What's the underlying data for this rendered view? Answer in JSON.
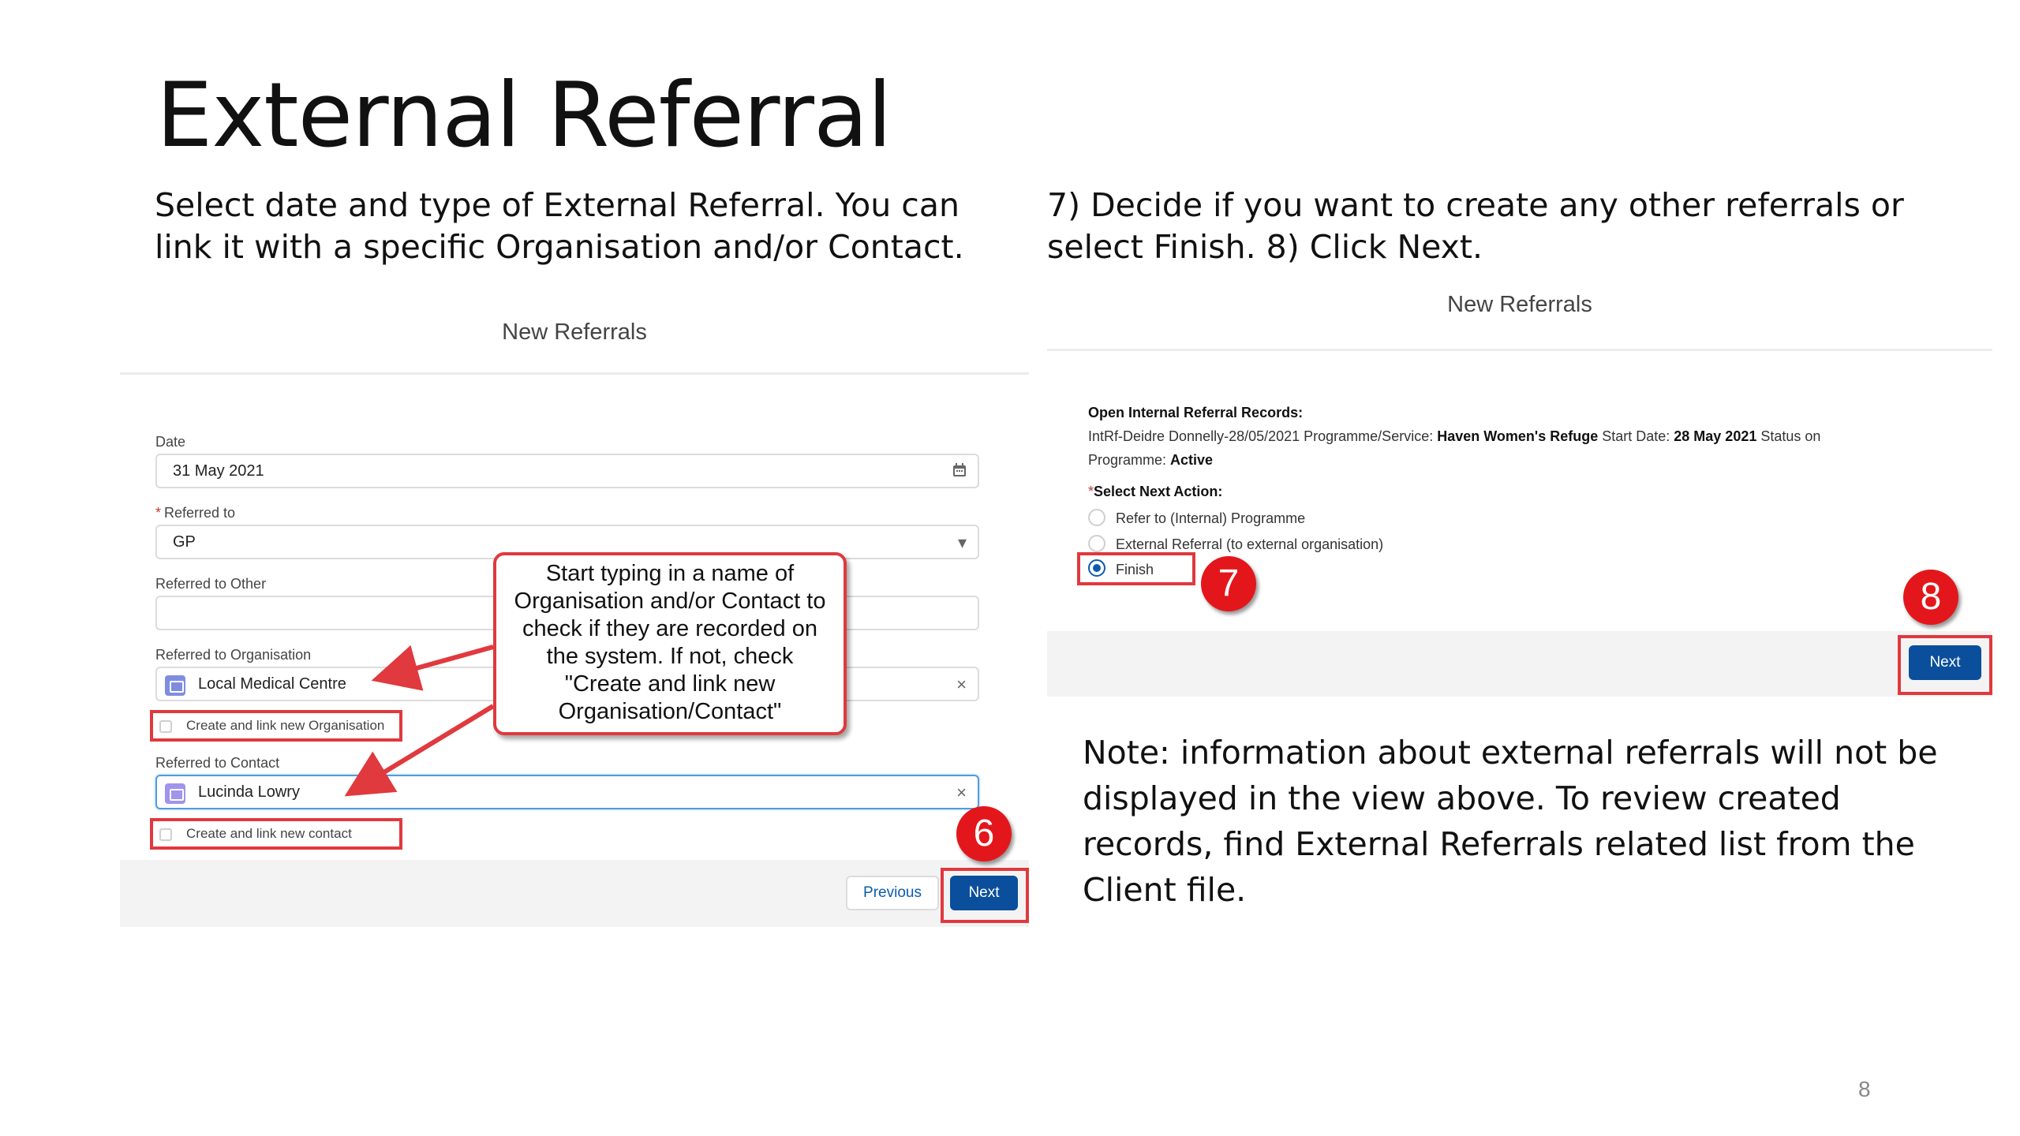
{
  "slide": {
    "title": "External Referral",
    "left_intro": "Select date and type of External Referral. You can link it with a specific Organisation and/or Contact.",
    "right_intro": "7) Decide if you want to create any other referrals or select Finish. 8) Click Next.",
    "note": "Note: information about external referrals will not be displayed in the view above. To review created records, find External Referrals related list from the Client file.",
    "page_number": "8"
  },
  "left_form": {
    "header": "New Referrals",
    "date_label": "Date",
    "date_value": "31 May 2021",
    "date_icon": "calendar-icon",
    "referred_to_required": "*",
    "referred_to_label": "Referred to",
    "referred_to_value": "GP",
    "referred_to_other_label": "Referred to Other",
    "referred_to_other_value": "",
    "organisation_label": "Referred to Organisation",
    "organisation_value": "Local Medical Centre",
    "create_org_label": "Create and link new Organisation",
    "contact_label": "Referred to Contact",
    "contact_value": "Lucinda Lowry",
    "create_contact_label": "Create and link new contact",
    "previous_button": "Previous",
    "next_button": "Next",
    "clear_glyph": "×",
    "dropdown_glyph": "▾"
  },
  "callout": {
    "text": "Start typing in a name of Organisation and/or Contact to check if they are recorded on the system. If not, check \"Create and link new Organisation/Contact\""
  },
  "right_form": {
    "header": "New Referrals",
    "open_records_heading": "Open Internal Referral Records:",
    "record_prefix": "IntRf-Deidre Donnelly-28/05/2021 Programme/Service: ",
    "record_service": "Haven Women's Refuge",
    "record_start_label": " Start Date: ",
    "record_start_value": "28 May 2021",
    "record_status_label": " Status on",
    "record_programme_label": "Programme: ",
    "record_status_value": "Active",
    "next_action_required": "*",
    "next_action_label": "Select Next Action:",
    "options": [
      {
        "label": "Refer to (Internal) Programme",
        "selected": false
      },
      {
        "label": "External Referral (to external organisation)",
        "selected": false
      },
      {
        "label": "Finish",
        "selected": true
      }
    ],
    "next_button": "Next"
  },
  "badges": [
    "6",
    "7",
    "8"
  ],
  "colors": {
    "highlight_red": "#e0393e",
    "badge_red": "#e3171b",
    "brand_blue": "#0b4f9c",
    "focus_blue": "#4f9ce0"
  }
}
